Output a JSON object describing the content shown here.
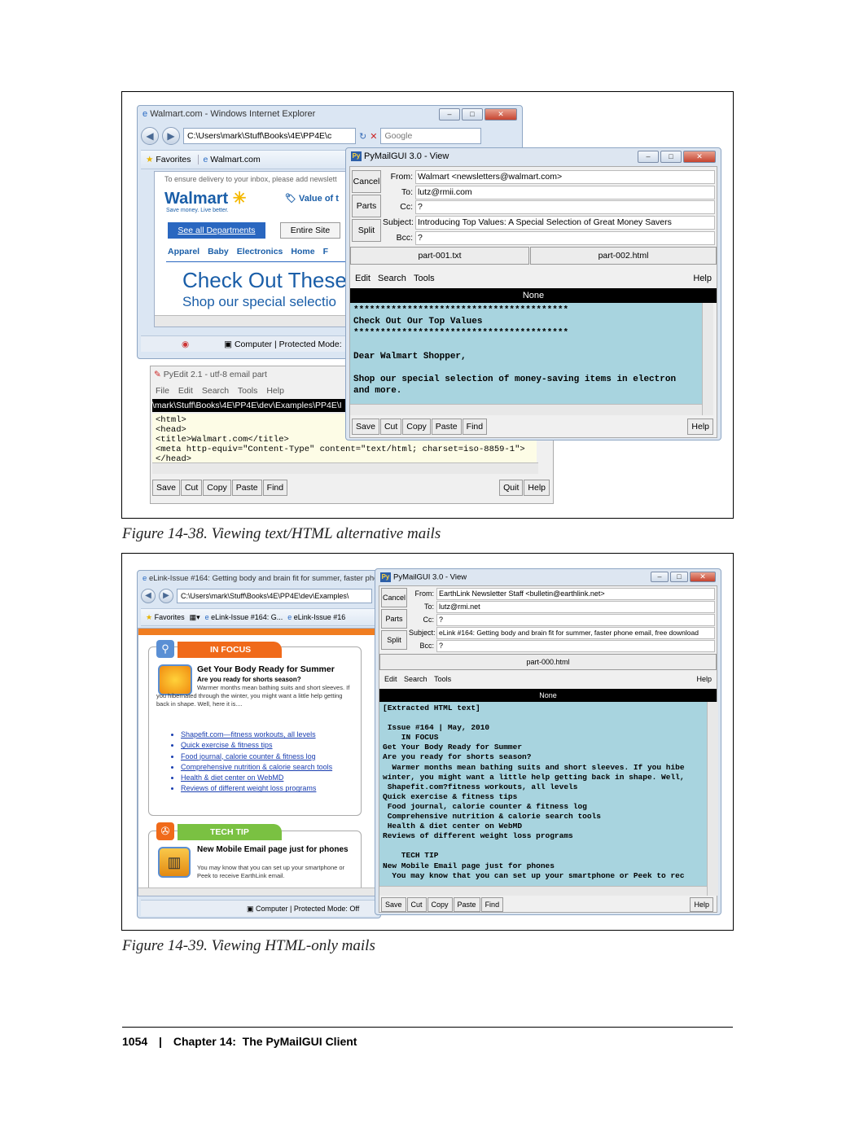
{
  "figure1": {
    "caption": "Figure 14-38. Viewing text/HTML alternative mails",
    "ie": {
      "title": "Walmart.com - Windows Internet Explorer",
      "address": "C:\\Users\\mark\\Stuff\\Books\\4E\\PP4E\\c",
      "search_placeholder": "Google",
      "favorites": "Favorites",
      "tab": "Walmart.com",
      "notice": "To ensure delivery to your inbox, please add newslett",
      "logo": "Walmart",
      "tagline": "Save money. Live better.",
      "value_link": "Value of t",
      "departments_button": "See all Departments",
      "entire_site": "Entire Site",
      "nav": [
        "Apparel",
        "Baby",
        "Electronics",
        "Home",
        "F"
      ],
      "headline": "Check Out These",
      "subline": "Shop our special selectio",
      "status": "Computer | Protected Mode:"
    },
    "pyedit": {
      "title": "PyEdit 2.1 - utf-8 email part",
      "menu": [
        "File",
        "Edit",
        "Search",
        "Tools",
        "Help"
      ],
      "path": "\\mark\\Stuff\\Books\\4E\\PP4E\\dev\\Examples\\PP4E\\I",
      "code": "<html>\n<head>\n<title>Walmart.com</title>\n<meta http-equiv=\"Content-Type\" content=\"text/html; charset=iso-8859-1\">\n</head>",
      "tools": [
        "Save",
        "Cut",
        "Copy",
        "Paste",
        "Find"
      ],
      "quit": "Quit",
      "help": "Help"
    },
    "pymail": {
      "title": "PyMailGUI 3.0 - View",
      "side_buttons": [
        "Cancel",
        "Parts",
        "Split"
      ],
      "headers": [
        {
          "label": "From:",
          "value": "Walmart <newsletters@walmart.com>"
        },
        {
          "label": "To:",
          "value": "lutz@rmii.com"
        },
        {
          "label": "Cc:",
          "value": "?"
        },
        {
          "label": "Subject:",
          "value": "Introducing Top Values: A Special Selection of Great Money Savers"
        },
        {
          "label": "Bcc:",
          "value": "?"
        }
      ],
      "parts": [
        "part-001.txt",
        "part-002.html"
      ],
      "menu": [
        "Edit",
        "Search",
        "Tools"
      ],
      "help": "Help",
      "status": "None",
      "body": "****************************************\nCheck Out Our Top Values\n****************************************\n\nDear Walmart Shopper,\n\nShop our special selection of money-saving items in electron\nand more.",
      "tools": [
        "Save",
        "Cut",
        "Copy",
        "Paste",
        "Find"
      ]
    }
  },
  "figure2": {
    "caption": "Figure 14-39. Viewing HTML-only mails",
    "ie": {
      "title": "eLink-Issue #164: Getting body and brain fit for summer, faster phon",
      "address": "C:\\Users\\mark\\Stuff\\Books\\4E\\PP4E\\dev\\Examples\\",
      "favorites": "Favorites",
      "tab1": "eLink-Issue #164: G...",
      "tab2": "eLink-Issue #16",
      "focus_header": "IN FOCUS",
      "focus_title": "Get Your Body Ready for Summer",
      "focus_sub": "Are you ready for shorts season?",
      "focus_text": "Warmer months mean bathing suits and short sleeves. If you hibernated through the winter, you might want a little help getting back in shape. Well, here it is....",
      "links": [
        "Shapefit.com—fitness workouts, all levels",
        "Quick exercise & fitness tips",
        "Food journal, calorie counter & fitness log",
        "Comprehensive nutrition & calorie search tools",
        "Health & diet center on WebMD",
        "Reviews of different weight loss programs"
      ],
      "tip_header": "TECH TIP",
      "tip_title": "New Mobile Email page just for phones",
      "tip_text": "You may know that you can set up your smartphone or Peek to receive EarthLink email.",
      "status": "Computer | Protected Mode: Off"
    },
    "pymail": {
      "title": "PyMailGUI 3.0 - View",
      "side_buttons": [
        "Cancel",
        "Parts",
        "Split"
      ],
      "headers": [
        {
          "label": "From:",
          "value": "EarthLink Newsletter Staff <bulletin@earthlink.net>"
        },
        {
          "label": "To:",
          "value": "lutz@rmi.net"
        },
        {
          "label": "Cc:",
          "value": "?"
        },
        {
          "label": "Subject:",
          "value": "eLink #164: Getting body and brain fit for summer, faster phone email, free download"
        },
        {
          "label": "Bcc:",
          "value": "?"
        }
      ],
      "parts": [
        "part-000.html"
      ],
      "menu": [
        "Edit",
        "Search",
        "Tools"
      ],
      "help": "Help",
      "status": "None",
      "body": "[Extracted HTML text]\n\n Issue #164 | May, 2010\n    IN FOCUS\nGet Your Body Ready for Summer\nAre you ready for shorts season?\n  Warmer months mean bathing suits and short sleeves. If you hibe\nwinter, you might want a little help getting back in shape. Well,\n Shapefit.com?fitness workouts, all levels\nQuick exercise & fitness tips\n Food journal, calorie counter & fitness log\n Comprehensive nutrition & calorie search tools\n Health & diet center on WebMD\nReviews of different weight loss programs\n\n    TECH TIP\nNew Mobile Email page just for phones\n  You may know that you can set up your smartphone or Peek to rec",
      "tools": [
        "Save",
        "Cut",
        "Copy",
        "Paste",
        "Find"
      ]
    }
  },
  "footer": {
    "page_number": "1054",
    "separator": "|",
    "chapter": "Chapter 14:  The PyMailGUI Client"
  }
}
